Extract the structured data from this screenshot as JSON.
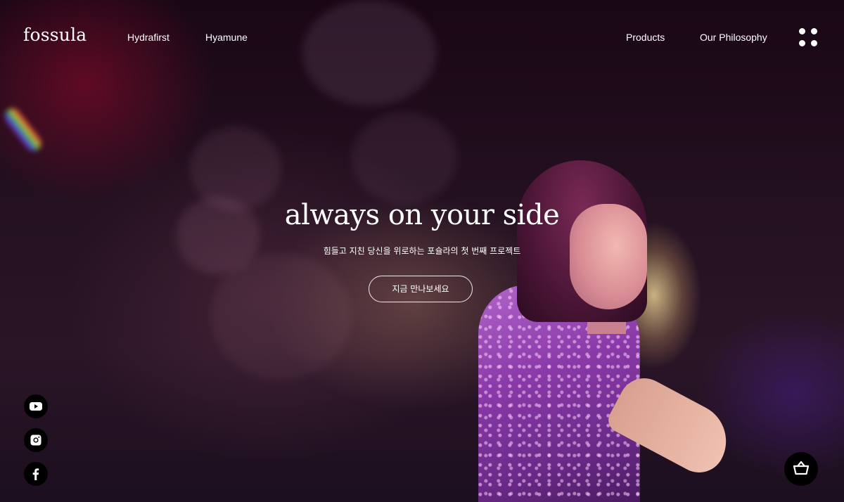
{
  "header": {
    "logo": "fossula",
    "nav": {
      "hydrafirst": "Hydrafirst",
      "hyamune": "Hyamune",
      "products": "Products",
      "philosophy": "Our Philosophy"
    },
    "menu_icon": "grid-dots-icon"
  },
  "hero": {
    "title": "always on your side",
    "subtitle": "힘들고 지친 당신을 위로하는 포슐라의 첫 번째 프로젝트",
    "cta_label": "지금 만나보세요"
  },
  "social": [
    {
      "name": "youtube-icon"
    },
    {
      "name": "instagram-icon"
    },
    {
      "name": "facebook-icon"
    }
  ],
  "cart": {
    "icon": "shopping-basket-icon"
  },
  "colors": {
    "text": "#ffffff",
    "icon_background": "#000000",
    "background_dark": "#1a0715",
    "accent_purple": "#8a3aa8"
  }
}
